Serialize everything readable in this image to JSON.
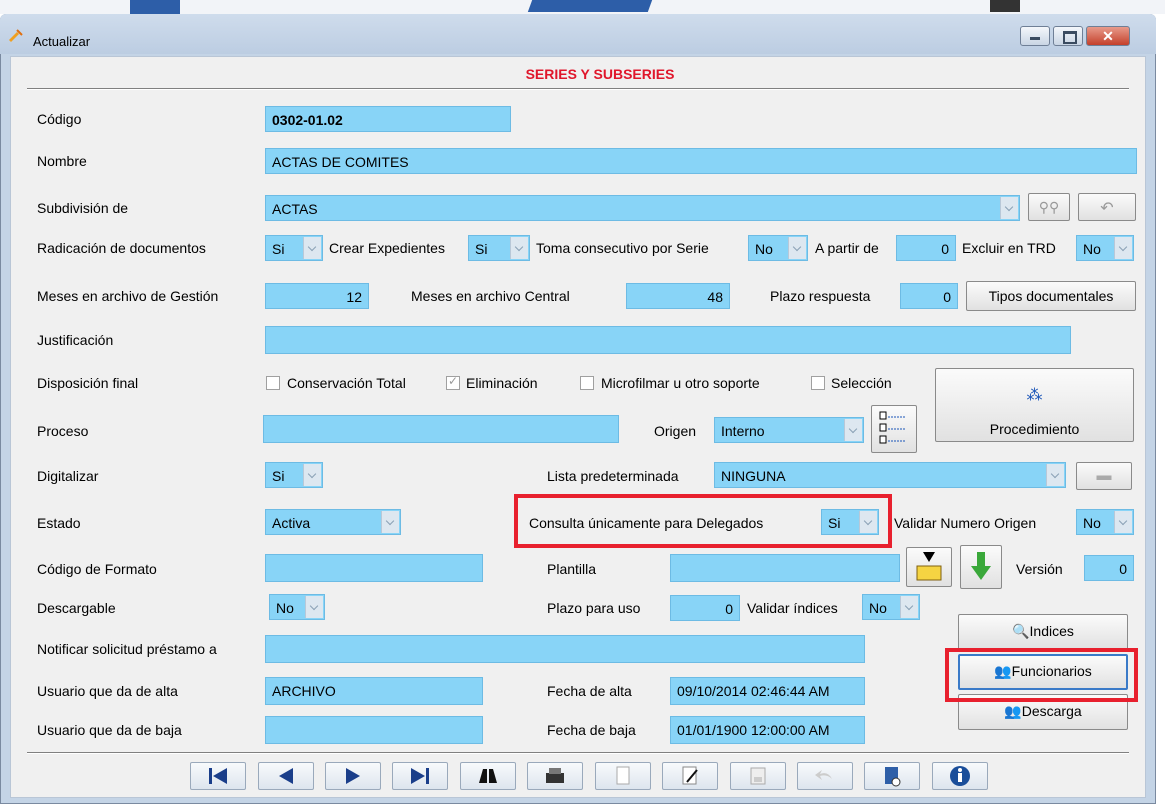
{
  "window": {
    "title": "Actualizar"
  },
  "header": "SERIES Y SUBSERIES",
  "fields": {
    "codigo": {
      "label": "Código",
      "value": "0302-01.02"
    },
    "nombre": {
      "label": "Nombre",
      "value": "ACTAS DE COMITES"
    },
    "subdivision": {
      "label": "Subdivisión de",
      "value": "ACTAS"
    },
    "radicacion": {
      "label": "Radicación de documentos",
      "value": "Si"
    },
    "crear_expedientes": {
      "label": "Crear Expedientes",
      "value": "Si"
    },
    "toma_consecutivo": {
      "label": "Toma consecutivo por Serie",
      "value": "No"
    },
    "apartir": {
      "label": "A partir de",
      "value": "0"
    },
    "excluir_trd": {
      "label": "Excluir en TRD",
      "value": "No"
    },
    "meses_gestion": {
      "label": "Meses en archivo de Gestión",
      "value": "12"
    },
    "meses_central": {
      "label": "Meses en archivo Central",
      "value": "48"
    },
    "plazo_respuesta": {
      "label": "Plazo respuesta",
      "value": "0"
    },
    "justificacion": {
      "label": "Justificación",
      "value": ""
    },
    "disposicion": {
      "label": "Disposición final",
      "options": [
        {
          "label": "Conservación Total",
          "checked": false
        },
        {
          "label": "Eliminación",
          "checked": true
        },
        {
          "label": "Microfilmar u otro soporte",
          "checked": false
        },
        {
          "label": "Selección",
          "checked": false
        }
      ]
    },
    "proceso": {
      "label": "Proceso",
      "value": ""
    },
    "origen": {
      "label": "Origen",
      "value": "Interno"
    },
    "digitalizar": {
      "label": "Digitalizar",
      "value": "Si"
    },
    "lista_predeterminada": {
      "label": "Lista predeterminada",
      "value": "NINGUNA"
    },
    "estado": {
      "label": "Estado",
      "value": "Activa"
    },
    "consulta_delegados": {
      "label": "Consulta únicamente para Delegados",
      "value": "Si"
    },
    "validar_numero_origen": {
      "label": "Validar Numero Origen",
      "value": "No"
    },
    "codigo_formato": {
      "label": "Código de Formato",
      "value": ""
    },
    "plantilla": {
      "label": "Plantilla",
      "value": ""
    },
    "version": {
      "label": "Versión",
      "value": "0"
    },
    "descargable": {
      "label": "Descargable",
      "value": "No"
    },
    "plazo_uso": {
      "label": "Plazo para uso",
      "value": "0"
    },
    "validar_indices": {
      "label": "Validar índices",
      "value": "No"
    },
    "notificar": {
      "label": "Notificar solicitud préstamo a",
      "value": ""
    },
    "usuario_alta": {
      "label": "Usuario que da de alta",
      "value": "ARCHIVO"
    },
    "fecha_alta": {
      "label": "Fecha de alta",
      "value": "09/10/2014 02:46:44 AM"
    },
    "usuario_baja": {
      "label": "Usuario que da de baja",
      "value": ""
    },
    "fecha_baja": {
      "label": "Fecha de baja",
      "value": "01/01/1900 12:00:00 AM"
    }
  },
  "buttons": {
    "tipos_documentales": "Tipos documentales",
    "procedimiento": "Procedimiento",
    "indices": "Indices",
    "funcionarios": "Funcionarios",
    "descarga": "Descarga"
  },
  "colors": {
    "field_bg": "#88d4f7",
    "header": "#e0162b",
    "highlight": "#e8202e"
  }
}
